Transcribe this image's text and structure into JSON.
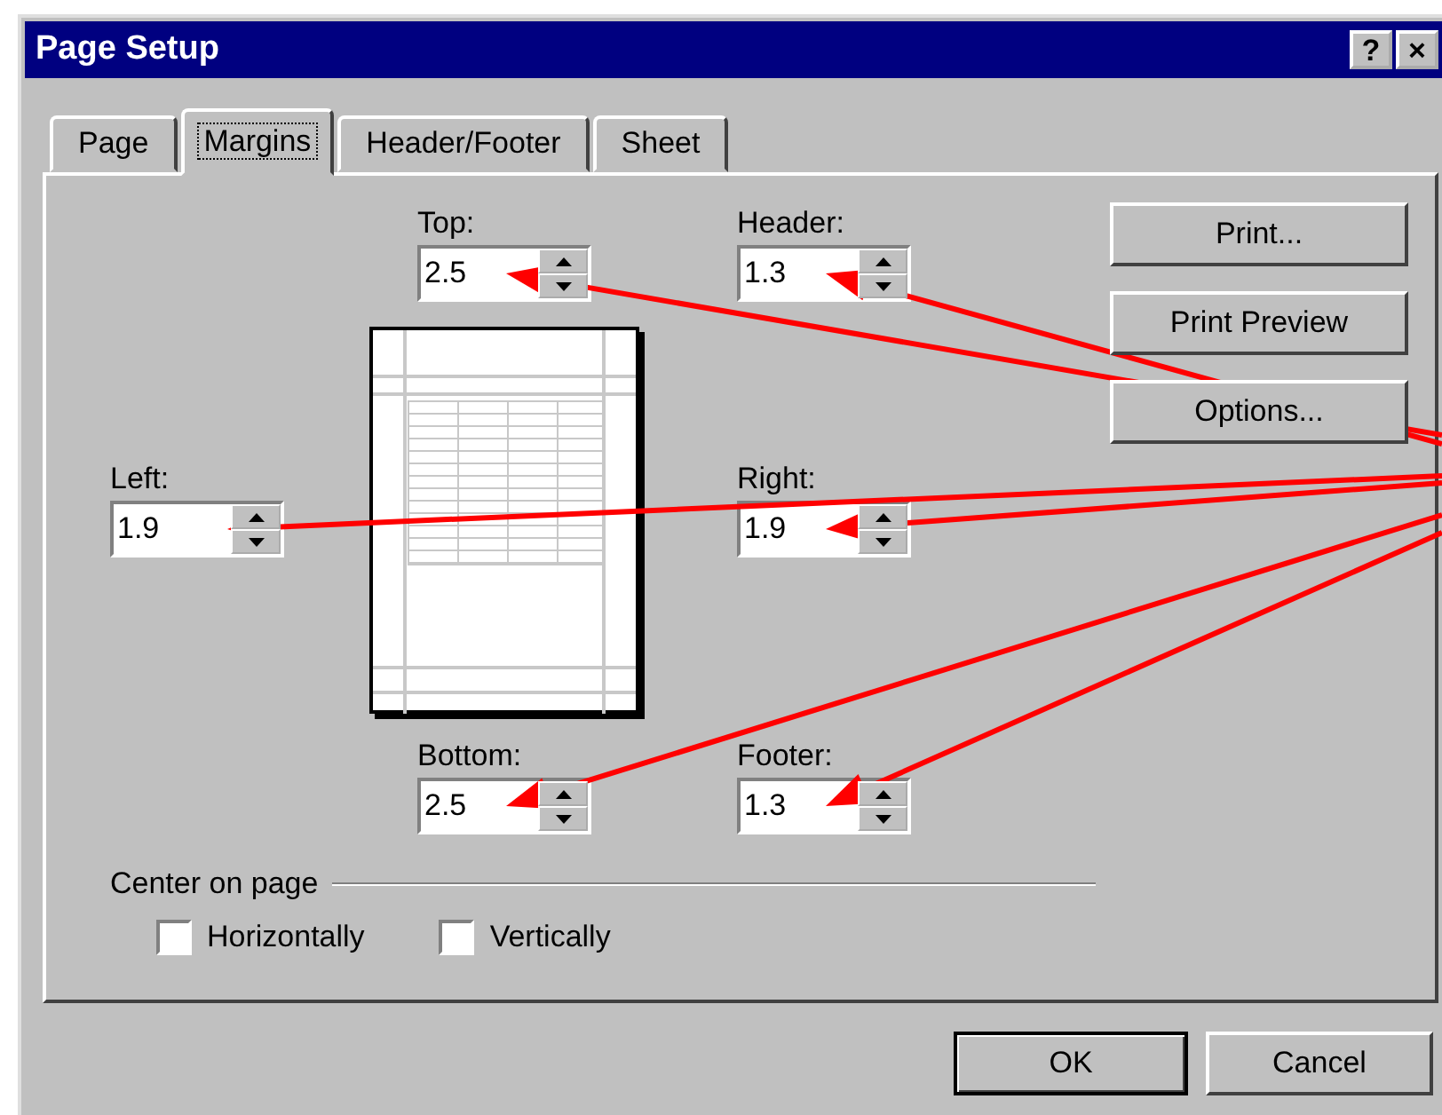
{
  "window": {
    "title": "Page Setup",
    "title_buttons": [
      "?",
      "×"
    ]
  },
  "tabs": [
    {
      "label": "Page",
      "selected": false
    },
    {
      "label": "Margins",
      "selected": true
    },
    {
      "label": "Header/Footer",
      "selected": false
    },
    {
      "label": "Sheet",
      "selected": false
    }
  ],
  "margin_fields": [
    {
      "label": "Top:",
      "value": "2.5",
      "arrow": true
    },
    {
      "label": "Header:",
      "value": "1.3",
      "arrow": true
    },
    {
      "label": "Left:",
      "value": "1.9",
      "arrow": true
    },
    {
      "label": "Right:",
      "value": "1.9",
      "arrow": true
    },
    {
      "label": "Bottom:",
      "value": "2.5",
      "arrow": true
    },
    {
      "label": "Footer:",
      "value": "1.3",
      "arrow": true
    }
  ],
  "side_buttons": [
    "Print...",
    "Print Preview",
    "Options..."
  ],
  "center_on_page": {
    "title": "Center on page",
    "options": [
      {
        "label": "Horizontally",
        "checked": false
      },
      {
        "label": "Vertically",
        "checked": false
      }
    ]
  },
  "dialog_buttons": [
    {
      "label": "OK",
      "default": true
    },
    {
      "label": "Cancel",
      "default": false
    }
  ]
}
